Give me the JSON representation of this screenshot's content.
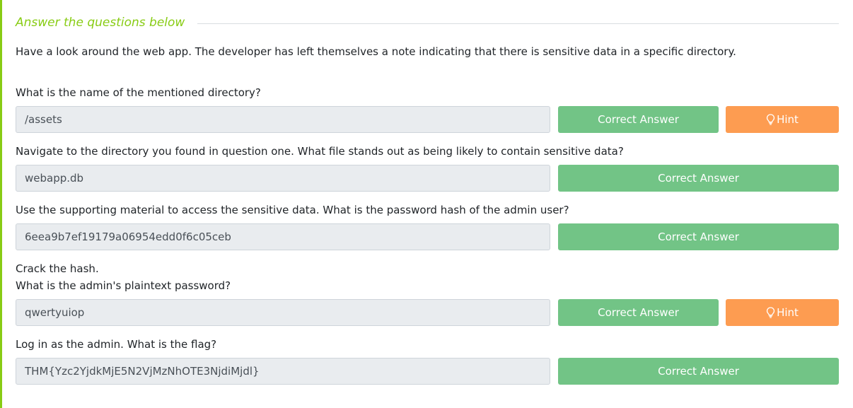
{
  "theme": {
    "accent": "#88cc14",
    "heading": "#88cc14",
    "correct_bg": "#72c486",
    "hint_bg": "#fd9c51"
  },
  "section": {
    "title": "Answer the questions below",
    "intro": "Have a look around the web app. The developer has left themselves a note indicating that there is sensitive data in a specific directory."
  },
  "questions": [
    {
      "text": "What is the name of the mentioned directory?",
      "answer": "/assets",
      "button": "Correct Answer",
      "hint": "Hint"
    },
    {
      "text": "Navigate to the directory you found in question one. What file stands out as being likely to contain sensitive data?",
      "answer": "webapp.db",
      "button": "Correct Answer"
    },
    {
      "text": "Use the supporting material to access the sensitive data. What is the password hash of the admin user?",
      "answer": "6eea9b7ef19179a06954edd0f6c05ceb",
      "button": "Correct Answer"
    },
    {
      "text_line1": "Crack the hash.",
      "text_line2": "What is the admin's plaintext password?",
      "answer": "qwertyuiop",
      "button": "Correct Answer",
      "hint": "Hint"
    },
    {
      "text": "Log in as the admin. What is the flag?",
      "answer": "THM{Yzc2YjdkMjE5N2VjMzNhOTE3NjdiMjdl}",
      "button": "Correct Answer"
    }
  ]
}
